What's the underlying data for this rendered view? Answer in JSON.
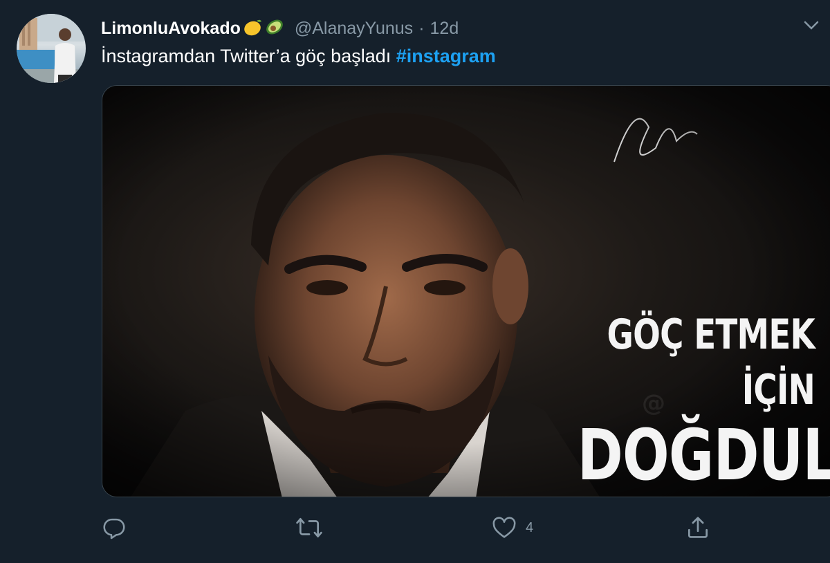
{
  "tweet": {
    "display_name": "LimonluAvokado",
    "emojis": [
      "lemon-emoji",
      "avocado-emoji"
    ],
    "handle": "@AlanayYunus",
    "separator": "·",
    "time": "12d",
    "text": "İnstagramdan Twitter’a göç başladı ",
    "hashtag": "#instagram",
    "media": {
      "line1": "GÖÇ ETMEK İÇİN",
      "line2": "DOĞDULAR"
    },
    "actions": {
      "reply_icon": "reply-icon",
      "retweet_icon": "retweet-icon",
      "like_icon": "heart-icon",
      "like_count": "4",
      "share_icon": "share-icon"
    }
  },
  "colors": {
    "background": "#15202b",
    "secondary_text": "#8899a6",
    "link": "#1da1f2"
  }
}
